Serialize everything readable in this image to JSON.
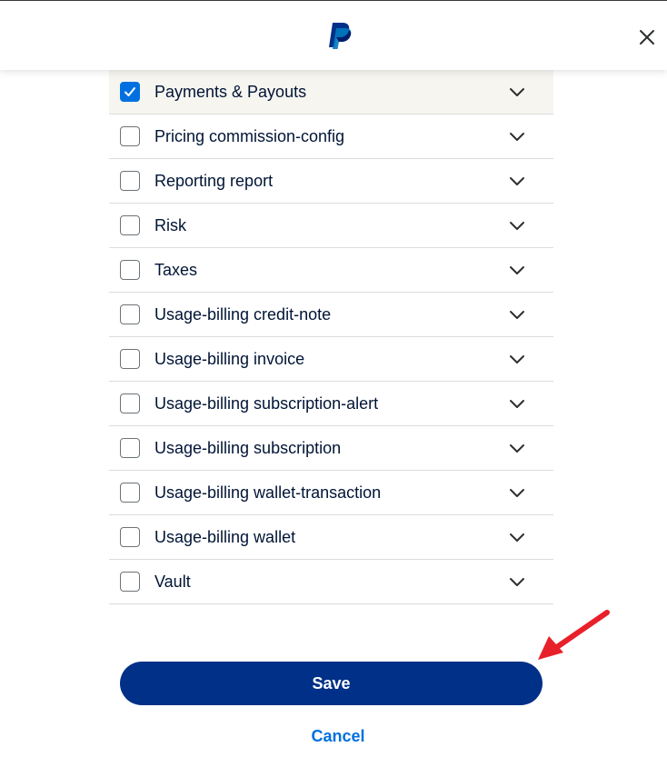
{
  "header": {
    "logo_icon": "paypal-logo",
    "close_icon": "close-icon"
  },
  "colors": {
    "primary": "#003087",
    "accent": "#0070e0",
    "annotation_arrow": "#e8202a"
  },
  "scopes": [
    {
      "label": "Payments & Payouts",
      "checked": true
    },
    {
      "label": "Pricing commission-config",
      "checked": false
    },
    {
      "label": "Reporting report",
      "checked": false
    },
    {
      "label": "Risk",
      "checked": false
    },
    {
      "label": "Taxes",
      "checked": false
    },
    {
      "label": "Usage-billing credit-note",
      "checked": false
    },
    {
      "label": "Usage-billing invoice",
      "checked": false
    },
    {
      "label": "Usage-billing subscription-alert",
      "checked": false
    },
    {
      "label": "Usage-billing subscription",
      "checked": false
    },
    {
      "label": "Usage-billing wallet-transaction",
      "checked": false
    },
    {
      "label": "Usage-billing wallet",
      "checked": false
    },
    {
      "label": "Vault",
      "checked": false
    }
  ],
  "actions": {
    "save_label": "Save",
    "cancel_label": "Cancel"
  }
}
